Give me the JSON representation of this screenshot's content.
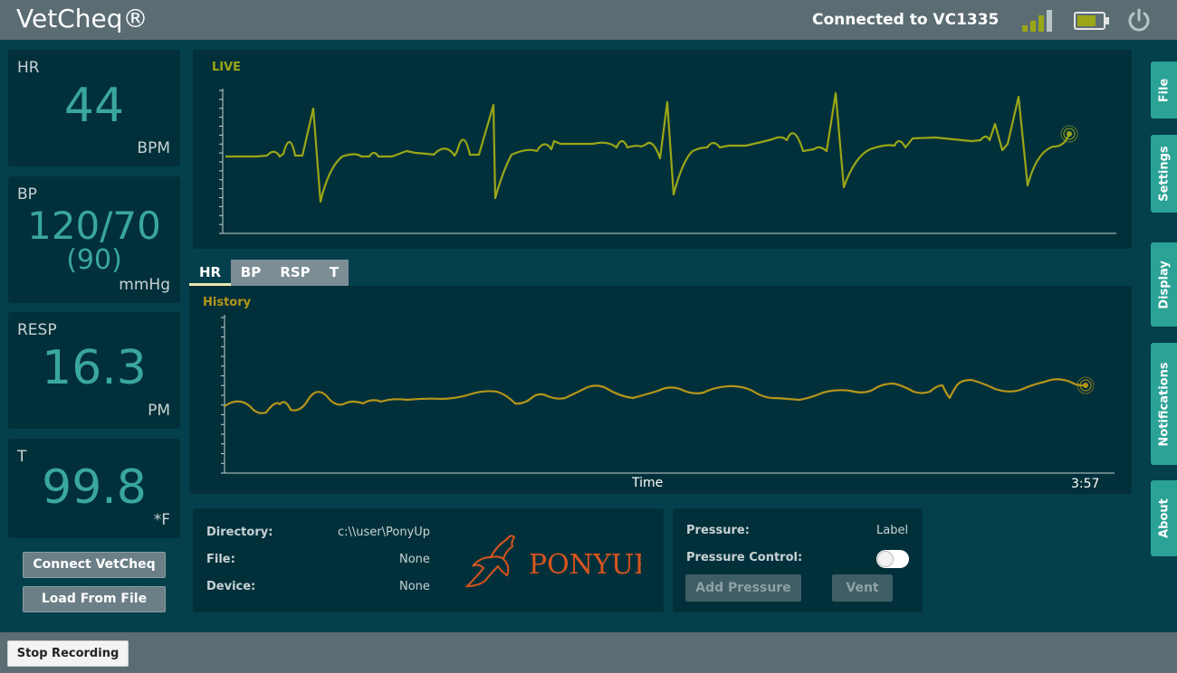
{
  "header": {
    "app_title": "VetCheq®",
    "connection": "Connected to VC1335",
    "icons": {
      "signal": "signal-strength-icon",
      "battery": "battery-icon",
      "power": "power-icon"
    }
  },
  "vitals": {
    "hr": {
      "label": "HR",
      "value": "44",
      "unit": "BPM"
    },
    "bp": {
      "label": "BP",
      "value": "120/70",
      "sub": "(90)",
      "unit": "mmHg"
    },
    "resp": {
      "label": "RESP",
      "value": "16.3",
      "unit": "PM"
    },
    "temp": {
      "label": "T",
      "value": "99.8",
      "unit": "*F"
    }
  },
  "buttons": {
    "connect": "Connect VetCheq",
    "load": "Load From File",
    "stop": "Stop Recording"
  },
  "live": {
    "label": "LIVE"
  },
  "tabs": [
    {
      "label": "HR",
      "active": true
    },
    {
      "label": "BP",
      "active": false
    },
    {
      "label": "RSP",
      "active": false
    },
    {
      "label": "T",
      "active": false
    }
  ],
  "history": {
    "label": "History",
    "xlabel": "Time",
    "time": "3:57"
  },
  "side_tabs": [
    "File",
    "Settings",
    "Display",
    "Notifications",
    "About"
  ],
  "file_info": {
    "directory_label": "Directory:",
    "directory_value": "c:\\\\user\\PonyUp",
    "file_label": "File:",
    "file_value": "None",
    "device_label": "Device:",
    "device_value": "None",
    "logo_text": "PONYUP"
  },
  "pressure": {
    "pressure_label": "Pressure:",
    "pressure_value": "Label",
    "control_label": "Pressure Control:",
    "control_on": false,
    "add_button": "Add Pressure",
    "vent_button": "Vent"
  },
  "colors": {
    "teal_value": "#3aa6a0",
    "live_trace": "#9aa617",
    "history_trace": "#b5951a",
    "side_tab": "#2aa295",
    "header": "#5b6d73"
  }
}
